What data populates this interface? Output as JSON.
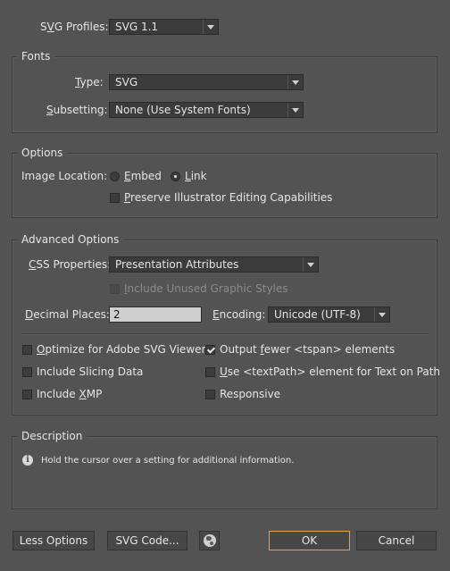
{
  "svg_profiles": {
    "label": "SVG Profiles:",
    "value": "SVG 1.1"
  },
  "fonts": {
    "title": "Fonts",
    "type_label": "Type:",
    "type_value": "SVG",
    "subsetting_label": "Subsetting:",
    "subsetting_value": "None (Use System Fonts)"
  },
  "options": {
    "title": "Options",
    "image_location_label": "Image Location:",
    "embed_label": "Embed",
    "embed_checked": false,
    "link_label": "Link",
    "link_checked": true,
    "preserve_label": "Preserve Illustrator Editing Capabilities",
    "preserve_checked": false
  },
  "advanced": {
    "title": "Advanced Options",
    "css_label": "CSS Properties:",
    "css_value": "Presentation Attributes",
    "include_unused_label": "Include Unused Graphic Styles",
    "decimal_label": "Decimal Places:",
    "decimal_value": "2",
    "encoding_label": "Encoding:",
    "encoding_value": "Unicode (UTF-8)",
    "optimize_label": "Optimize for Adobe SVG Viewer",
    "optimize_checked": false,
    "output_fewer_label": "Output fewer <tspan> elements",
    "output_fewer_checked": true,
    "slicing_label": "Include Slicing Data",
    "slicing_checked": false,
    "textpath_label": "Use <textPath> element for Text on Path",
    "textpath_checked": false,
    "xmp_label": "Include XMP",
    "xmp_checked": false,
    "responsive_label": "Responsive",
    "responsive_checked": false
  },
  "description": {
    "title": "Description",
    "text": "Hold the cursor over a setting for additional information."
  },
  "footer": {
    "less_options": "Less Options",
    "svg_code": "SVG Code...",
    "ok": "OK",
    "cancel": "Cancel",
    "globe_icon": "globe-icon"
  },
  "colors": {
    "background": "#535353",
    "default_button_border": "#e8a046"
  }
}
